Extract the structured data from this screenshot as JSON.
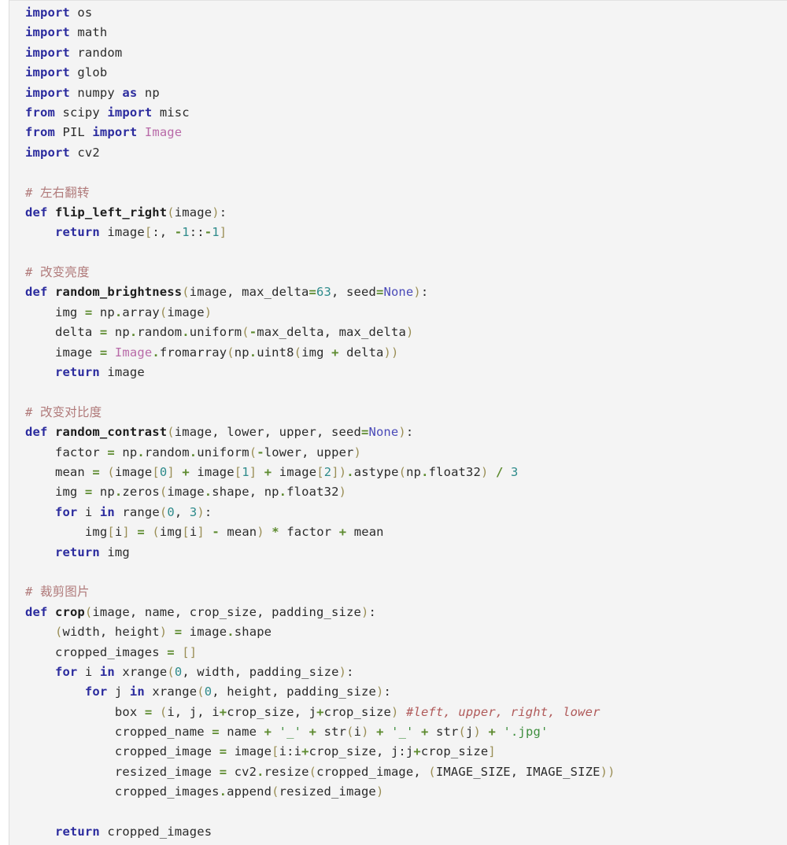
{
  "editor": {
    "language": "python",
    "background": "#f4f4f4",
    "page_background": "#ffffff",
    "gutter_rule_color": "#dcdcdc"
  },
  "palette": {
    "keyword": "#2b2b9e",
    "function_name": "#1c1c1c",
    "class_name": "#b86aa8",
    "builtin": "#4a4ab8",
    "number": "#2e8b8b",
    "operator": "#5c8a2e",
    "punctuation": "#9a8e55",
    "string": "#3f8f3f",
    "comment": "#b07a7a",
    "inline_comment": "#b05a5a",
    "identifier": "#2b2b2b"
  },
  "code": {
    "lines": [
      "import os",
      "import math",
      "import random",
      "import glob",
      "import numpy as np",
      "from scipy import misc",
      "from PIL import Image",
      "import cv2",
      "",
      "# 左右翻转",
      "def flip_left_right(image):",
      "    return image[:, -1::-1]",
      "",
      "# 改变亮度",
      "def random_brightness(image, max_delta=63, seed=None):",
      "    img = np.array(image)",
      "    delta = np.random.uniform(-max_delta, max_delta)",
      "    image = Image.fromarray(np.uint8(img + delta))",
      "    return image",
      "",
      "# 改变对比度",
      "def random_contrast(image, lower, upper, seed=None):",
      "    factor = np.random.uniform(-lower, upper)",
      "    mean = (image[0] + image[1] + image[2]).astype(np.float32) / 3",
      "    img = np.zeros(image.shape, np.float32)",
      "    for i in range(0, 3):",
      "        img[i] = (img[i] - mean) * factor + mean",
      "    return img",
      "",
      "# 裁剪图片",
      "def crop(image, name, crop_size, padding_size):",
      "    (width, height) = image.shape",
      "    cropped_images = []",
      "    for i in xrange(0, width, padding_size):",
      "        for j in xrange(0, height, padding_size):",
      "            box = (i, j, i+crop_size, j+crop_size) #left, upper, right, lower",
      "            cropped_name = name + '_' + str(i) + '_' + str(j) + '.jpg'",
      "            cropped_image = image[i:i+crop_size, j:j+crop_size]",
      "            resized_image = cv2.resize(cropped_image, (IMAGE_SIZE, IMAGE_SIZE))",
      "            cropped_images.append(resized_image)",
      "",
      "    return cropped_images"
    ],
    "comments": [
      "# 左右翻转",
      "# 改变亮度",
      "# 改变对比度",
      "# 裁剪图片",
      "#left, upper, right, lower"
    ],
    "functions": [
      "flip_left_right",
      "random_brightness",
      "random_contrast",
      "crop"
    ],
    "imports": [
      "os",
      "math",
      "random",
      "glob",
      "numpy",
      "scipy.misc",
      "PIL.Image",
      "cv2"
    ],
    "tokens": {
      "kw_import": "import",
      "kw_from": "from",
      "kw_as": "as",
      "kw_def": "def",
      "kw_return": "return",
      "kw_for": "for",
      "kw_in": "in",
      "builtin_none": "None",
      "class_image": "Image"
    }
  }
}
